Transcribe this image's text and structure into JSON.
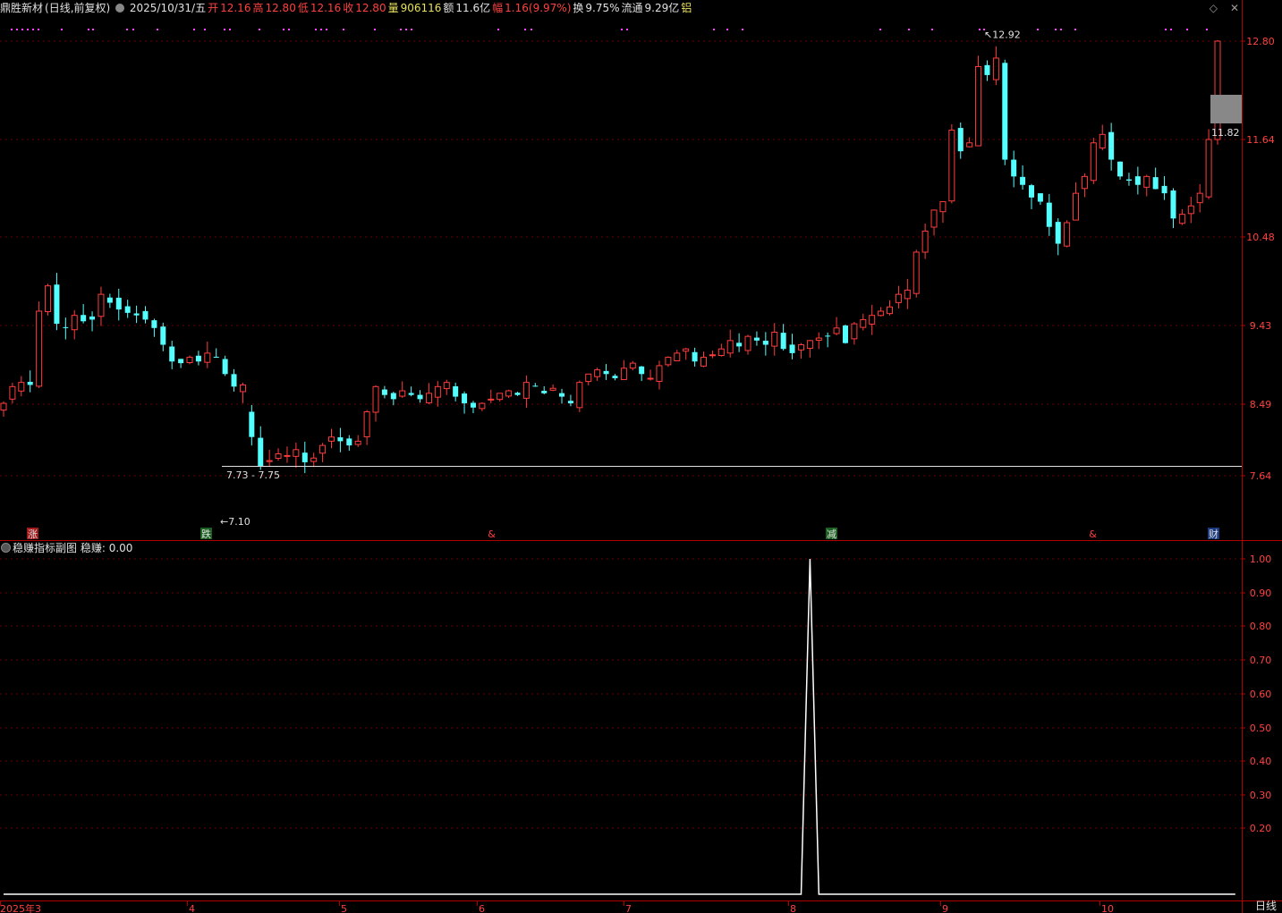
{
  "header": {
    "name": "鼎胜新材",
    "mode": "(日线,前复权)",
    "date": "2025/10/31/五",
    "open_label": "开",
    "open": "12.16",
    "high_label": "高",
    "high": "12.80",
    "low_label": "低",
    "low": "12.16",
    "close_label": "收",
    "close": "12.80",
    "vol_label": "量",
    "vol": "906116",
    "amt_label": "额",
    "amt": "11.6亿",
    "chg_label": "幅",
    "chg": "1.16(9.97%)",
    "turn_label": "换",
    "turn": "9.75%",
    "float_label": "流通",
    "float": "9.29亿",
    "sector": "铝"
  },
  "sub_header": {
    "title": "稳赚指标副图",
    "value": "稳赚: 0.00"
  },
  "period_label": "日线",
  "colors": {
    "up": "#ff3c3c",
    "down": "#54ffff",
    "axis": "#b00000",
    "grid": "#6a0000",
    "pink": "#ff40ff",
    "line": "#ffffff"
  },
  "chart_data": [
    {
      "type": "candlestick",
      "y_ticks": [
        "12.80",
        "11.64",
        "10.48",
        "9.43",
        "8.49",
        "7.64"
      ],
      "annotations": {
        "high": "12.92",
        "low": "7.10",
        "range": "7.73 - 7.75",
        "last": "11.82"
      },
      "event_markers": [
        {
          "label": "涨",
          "month": "3"
        },
        {
          "label": "跌",
          "month": "4"
        },
        {
          "label": "&",
          "month": "5"
        },
        {
          "label": "减",
          "month": "8"
        },
        {
          "label": "&",
          "month": "9"
        },
        {
          "label": "财",
          "month": "10"
        }
      ],
      "x_labels": [
        "2025年3",
        "4",
        "5",
        "6",
        "7",
        "8",
        "9",
        "10"
      ],
      "closes": [
        8.5,
        8.7,
        8.75,
        8.72,
        9.6,
        9.9,
        9.45,
        9.4,
        9.55,
        9.48,
        9.5,
        9.8,
        9.7,
        9.62,
        9.58,
        9.55,
        9.5,
        9.4,
        9.2,
        9.0,
        8.98,
        9.05,
        9.0,
        9.1,
        9.05,
        8.85,
        8.7,
        8.72,
        8.1,
        7.75,
        7.82,
        7.9,
        7.88,
        7.95,
        7.8,
        7.85,
        8.0,
        8.1,
        8.05,
        8.0,
        8.05,
        8.4,
        8.7,
        8.6,
        8.55,
        8.65,
        8.6,
        8.55,
        8.62,
        8.7,
        8.75,
        8.58,
        8.5,
        8.45,
        8.5,
        8.55,
        8.62,
        8.65,
        8.6,
        8.75,
        8.7,
        8.62,
        8.68,
        8.58,
        8.5,
        8.75,
        8.85,
        8.9,
        8.85,
        8.8,
        8.92,
        8.98,
        8.85,
        8.8,
        8.95,
        9.05,
        9.1,
        9.15,
        9.0,
        9.05,
        9.08,
        9.15,
        9.25,
        9.18,
        9.3,
        9.25,
        9.2,
        9.35,
        9.15,
        9.1,
        9.2,
        9.25,
        9.28,
        9.3,
        9.4,
        9.22,
        9.45,
        9.5,
        9.55,
        9.6,
        9.65,
        9.8,
        9.85,
        10.3,
        10.55,
        10.8,
        10.9,
        11.75,
        11.5,
        11.6,
        12.5,
        12.4,
        12.6,
        11.4,
        11.2,
        11.1,
        10.95,
        10.9,
        10.6,
        10.4,
        10.65,
        11.0,
        11.2,
        11.6,
        11.7,
        11.4,
        11.2,
        11.15,
        11.1,
        11.2,
        11.05,
        11.0,
        10.7,
        10.75,
        10.85,
        11.0,
        11.64,
        12.8
      ]
    },
    {
      "type": "line",
      "name": "稳赚",
      "y_ticks": [
        "1.00",
        "0.90",
        "0.80",
        "0.70",
        "0.60",
        "0.50",
        "0.40",
        "0.30",
        "0.20"
      ],
      "ylim": [
        0,
        1
      ],
      "values": [
        0,
        0,
        0,
        0,
        0,
        0,
        0,
        0,
        0,
        0,
        0,
        0,
        0,
        0,
        0,
        0,
        0,
        0,
        0,
        0,
        0,
        0,
        0,
        0,
        0,
        0,
        0,
        0,
        0,
        0,
        0,
        0,
        0,
        0,
        0,
        0,
        0,
        0,
        0,
        0,
        0,
        0,
        0,
        0,
        0,
        0,
        0,
        0,
        0,
        0,
        0,
        0,
        0,
        0,
        0,
        0,
        0,
        0,
        0,
        0,
        0,
        0,
        0,
        0,
        0,
        0,
        0,
        0,
        0,
        0,
        0,
        0,
        0,
        0,
        0,
        0,
        0,
        0,
        0,
        0,
        0,
        0,
        0,
        0,
        0,
        0,
        0,
        0,
        0,
        0,
        0,
        0,
        0,
        0,
        0,
        0,
        0,
        0,
        0,
        0,
        0,
        0,
        0,
        0,
        0,
        0,
        0,
        0,
        0,
        0,
        0,
        0,
        0,
        0,
        0,
        0,
        0,
        0,
        0,
        0,
        0,
        0,
        0,
        0,
        0,
        0,
        0,
        0,
        0,
        0,
        0,
        0,
        0,
        0,
        0,
        0,
        0,
        0,
        0,
        0
      ],
      "peak_day": 91,
      "peak": 1.0
    }
  ]
}
